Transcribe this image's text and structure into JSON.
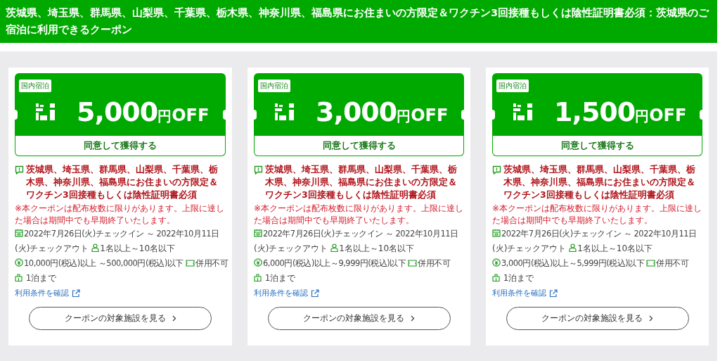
{
  "header": {
    "title": "茨城県、埼玉県、群馬県、山梨県、千葉県、栃木県、神奈川県、福島県にお住まいの方限定＆ワクチン3回接種もしくは陰性証明書必須：茨城県のご宿泊に利用できるクーポン"
  },
  "coupons": [
    {
      "category": "国内宿泊",
      "amount": "5,000",
      "unit": "円",
      "off": "OFF",
      "claim_button": "同意して獲得する",
      "restriction": "茨城県、埼玉県、群馬県、山梨県、千葉県、栃木県、神奈川県、福島県にお住まいの方限定＆ワクチン3回接種もしくは陰性証明書必須",
      "notice": "※本クーポンは配布枚数に限りがあります。上限に達した場合は期間中でも早期終了いたします。",
      "period_line_1": "2022年7月26日(火)チェックイン ～ 2022年10月11日",
      "period_line_2": "(火)チェックアウト",
      "guests": "1名以上～10名以下",
      "price_range": "10,000円(税込)以上 ～500,000円(税込)以下",
      "combination": "併用不可",
      "nights": "1泊まで",
      "terms_link": "利用条件を確認",
      "facilities_button": "クーポンの対象施設を見る"
    },
    {
      "category": "国内宿泊",
      "amount": "3,000",
      "unit": "円",
      "off": "OFF",
      "claim_button": "同意して獲得する",
      "restriction": "茨城県、埼玉県、群馬県、山梨県、千葉県、栃木県、神奈川県、福島県にお住まいの方限定＆ワクチン3回接種もしくは陰性証明書必須",
      "notice": "※本クーポンは配布枚数に限りがあります。上限に達した場合は期間中でも早期終了いたします。",
      "period_line_1": "2022年7月26日(火)チェックイン ～ 2022年10月11日",
      "period_line_2": "(火)チェックアウト",
      "guests": "1名以上～10名以下",
      "price_range": "6,000円(税込)以上～9,999円(税込)以下",
      "combination": "併用不可",
      "nights": "1泊まで",
      "terms_link": "利用条件を確認",
      "facilities_button": "クーポンの対象施設を見る"
    },
    {
      "category": "国内宿泊",
      "amount": "1,500",
      "unit": "円",
      "off": "OFF",
      "claim_button": "同意して獲得する",
      "restriction": "茨城県、埼玉県、群馬県、山梨県、千葉県、栃木県、神奈川県、福島県にお住まいの方限定＆ワクチン3回接種もしくは陰性証明書必須",
      "notice": "※本クーポンは配布枚数に限りがあります。上限に達した場合は期間中でも早期終了いたします。",
      "period_line_1": "2022年7月26日(火)チェックイン ～ 2022年10月11日",
      "period_line_2": "(火)チェックアウト",
      "guests": "1名以上～10名以下",
      "price_range": "3,000円(税込)以上～5,999円(税込)以下",
      "combination": "併用不可",
      "nights": "1泊まで",
      "terms_link": "利用条件を確認",
      "facilities_button": "クーポンの対象施設を見る"
    }
  ]
}
